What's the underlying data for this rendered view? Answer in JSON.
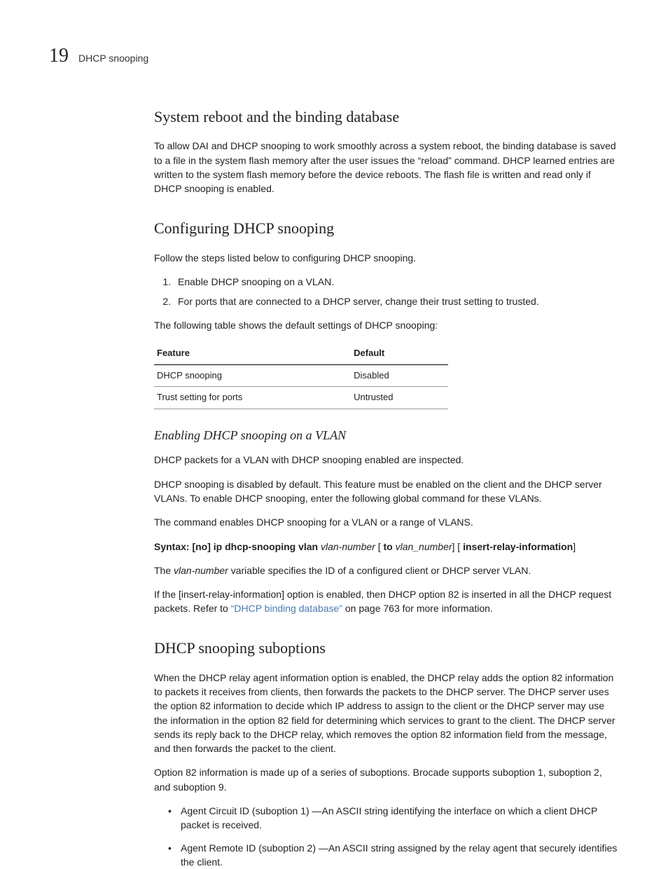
{
  "header": {
    "chapter_num": "19",
    "chapter_title": "DHCP snooping"
  },
  "s1": {
    "heading": "System reboot and the binding database",
    "p1": "To allow DAI and DHCP snooping to work smoothly across a system reboot, the binding database is saved to a file in the system flash memory after the user issues the “reload” command. DHCP learned entries are written to the system flash memory before the device reboots. The flash file is written and read only if DHCP snooping is enabled."
  },
  "s2": {
    "heading": "Configuring DHCP snooping",
    "p1": "Follow the steps listed below to configuring DHCP snooping.",
    "steps": [
      "Enable DHCP snooping on a VLAN.",
      "For ports that are connected to a DHCP server, change their trust setting to trusted."
    ],
    "p2": "The following table shows the default settings of DHCP snooping:",
    "table": {
      "h1": "Feature",
      "h2": "Default",
      "r1c1": "DHCP snooping",
      "r1c2": "Disabled",
      "r2c1": "Trust setting for ports",
      "r2c2": "Untrusted"
    }
  },
  "s3": {
    "heading": "Enabling DHCP snooping on a VLAN",
    "p1": "DHCP packets for a VLAN with DHCP snooping enabled are inspected.",
    "p2": "DHCP snooping is disabled by default. This feature must be enabled on the client and the DHCP server VLANs. To enable DHCP snooping, enter the following global command for these VLANs.",
    "p3": "The command enables DHCP snooping for a VLAN or a range of VLANS.",
    "syntax": {
      "label": "Syntax:",
      "part1": "  [no] ip dhcp-snooping vlan",
      "arg1": " vlan-number",
      "part2": " [ ",
      "to": "to",
      "arg2": " vlan_number",
      "part3": "] [ ",
      "opt": "insert-relay-information",
      "part4": "]"
    },
    "p4a": "The ",
    "p4i": "vlan-number",
    "p4b": " variable specifies the ID of a configured client or DHCP server VLAN.",
    "p5a": " If the [insert-relay-information] option is enabled, then DHCP option 82 is inserted in all the DHCP request packets. Refer to ",
    "p5link": "“DHCP binding database”",
    "p5b": " on page 763 for more information."
  },
  "s4": {
    "heading": "DHCP snooping suboptions",
    "p1": "When the DHCP relay agent information option is enabled, the DHCP relay adds the option 82 information to packets it receives from clients, then forwards the packets to the DHCP server. The DHCP server uses the option 82 information to decide which IP address to assign to the client or the DHCP server may use the information in the option 82 field for determining which services to grant to the client. The DHCP server sends its reply back to the DHCP relay, which removes the option 82 information field from the message, and then forwards the packet to the client.",
    "p2": "Option 82 information is made up of a series of suboptions. Brocade supports suboption 1, suboption 2, and suboption 9.",
    "bullets": [
      "Agent Circuit ID (suboption 1) —An ASCII string identifying the interface on which a client DHCP packet is received.",
      "Agent Remote ID (suboption 2) —An ASCII string assigned by the relay agent that securely identifies the client."
    ]
  }
}
